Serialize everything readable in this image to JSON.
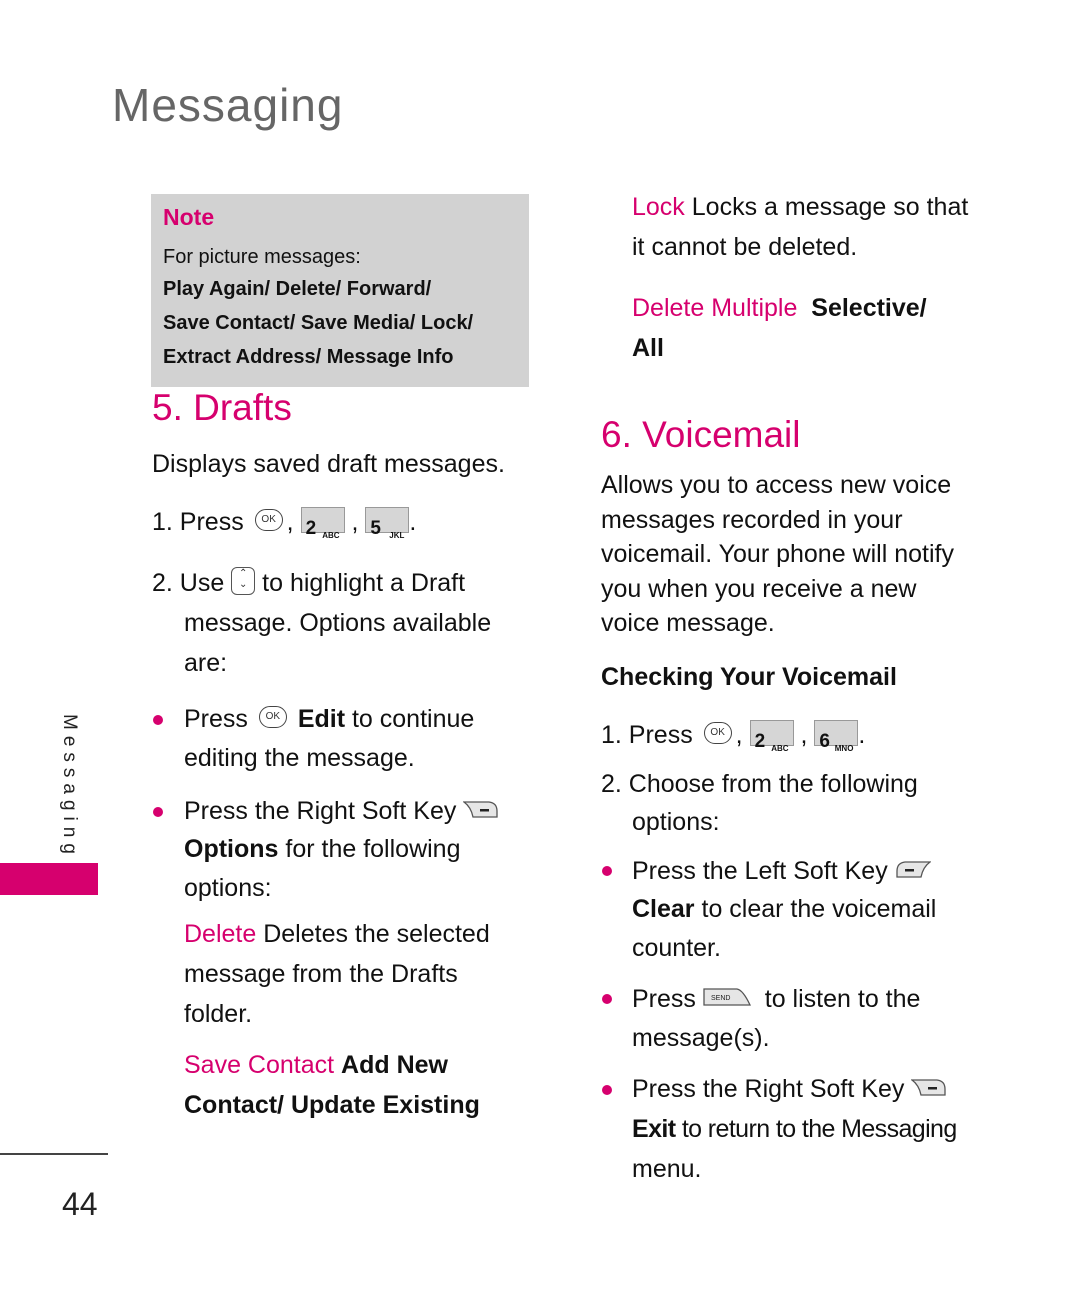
{
  "page": {
    "title": "Messaging",
    "side_tab_label": "Messaging",
    "page_number": "44",
    "accent_color": "#d6006e"
  },
  "note": {
    "label": "Note",
    "intro": "For picture messages:",
    "lines": [
      "Play Again/ Delete/ Forward/",
      "Save Contact/ Save Media/ Lock/",
      "Extract Address/ Message Info"
    ]
  },
  "drafts": {
    "heading": "5. Drafts",
    "description": "Displays saved draft messages.",
    "step1": {
      "prefix": "1. Press",
      "keys": [
        "OK",
        "2 ABC",
        "5 JKL"
      ],
      "sep": ",",
      "end": "."
    },
    "step2": {
      "prefix": "2. Use",
      "key": "navigation-key",
      "line1": "to highlight a Draft",
      "line2": "message. Options available",
      "line3": "are:"
    },
    "bullets": [
      {
        "prefix": "Press",
        "key": "OK",
        "bold": "Edit",
        "rest1": "to continue",
        "rest2": "editing the message."
      },
      {
        "line1": "Press the Right Soft Key",
        "key": "right-soft-key",
        "bold": "Options",
        "rest1": "for the following",
        "rest2": "options:"
      }
    ],
    "options": [
      {
        "term": "Delete",
        "desc1": "Deletes the selected",
        "desc2": "message from the Drafts",
        "desc3": "folder."
      },
      {
        "term": "Save Contact",
        "desc1": "Add New",
        "desc2": "Contact/ Update Existing"
      }
    ]
  },
  "continued_options": [
    {
      "term": "Lock",
      "desc1": "Locks a message so that",
      "desc2": "it cannot be deleted."
    },
    {
      "term": "Delete Multiple",
      "desc1": "Selective/",
      "desc2": "All"
    }
  ],
  "voicemail": {
    "heading": "6. Voicemail",
    "description": [
      "Allows you to access new voice",
      "messages recorded in your",
      "voicemail. Your phone will notify",
      "you when you receive a new",
      "voice message."
    ],
    "subheading": "Checking Your Voicemail",
    "step1": {
      "prefix": "1. Press",
      "keys": [
        "OK",
        "2 ABC",
        "6 MNO"
      ],
      "sep": ",",
      "end": "."
    },
    "step2": {
      "line1": "2. Choose from the following",
      "line2": "options:"
    },
    "bullets": [
      {
        "line1": "Press the Left Soft Key",
        "key": "left-soft-key",
        "bold": "Clear",
        "rest1": "to clear the voicemail",
        "rest2": "counter."
      },
      {
        "prefix": "Press",
        "key": "SEND",
        "rest1": "to listen to the",
        "rest2": "message(s)."
      },
      {
        "line1": "Press the Right Soft Key",
        "key": "right-soft-key",
        "bold": "Exit",
        "rest1": "to return to the Messaging",
        "rest2": "menu."
      }
    ]
  }
}
